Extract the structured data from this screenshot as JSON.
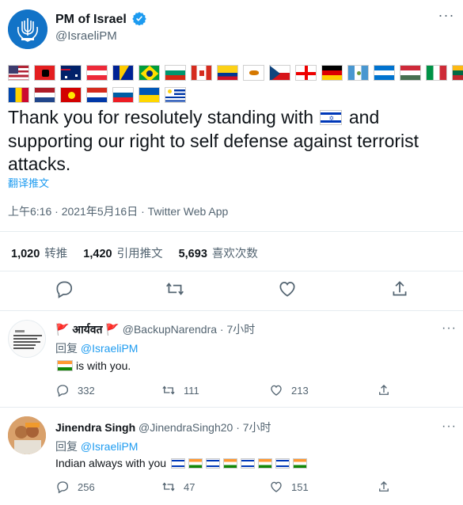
{
  "tweet": {
    "display_name": "PM of Israel",
    "handle": "@IsraeliPM",
    "text_before_flag": "Thank you for resolutely standing with",
    "text_after_flag": "and supporting our right to self defense against terrorist attacks.",
    "translate_label": "翻译推文",
    "timestamp": "上午6:16 · 2021年5月16日 · Twitter Web App",
    "stats": {
      "retweets_count": "1,020",
      "retweets_label": "转推",
      "quotes_count": "1,420",
      "quotes_label": "引用推文",
      "likes_count": "5,693",
      "likes_label": "喜欢次数"
    },
    "flags_row1": [
      "us-flag",
      "albania-flag",
      "australia-flag",
      "austria-flag",
      "bosnia-flag",
      "brazil-flag",
      "bulgaria-flag",
      "canada-flag",
      "colombia-flag",
      "cyprus-flag",
      "czech-flag",
      "georgia-flag",
      "germany-flag",
      "guatemala-flag",
      "honduras-flag",
      "hungary-flag",
      "italy-flag",
      "lithuania-flag"
    ],
    "flags_row2": [
      "moldova-flag",
      "netherlands-flag",
      "north-macedonia-flag",
      "paraguay-flag",
      "slovenia-flag",
      "ukraine-flag",
      "uruguay-flag"
    ]
  },
  "replies": [
    {
      "name": "आर्यवत",
      "handle": "@BackupNarendra",
      "time": "· 7小时",
      "reply_prefix": "回复",
      "reply_to": "@IsraeliPM",
      "text": "is with you.",
      "avatar_text": "We thank our friends in #India for supporting and standing with #Israel in its war against terror",
      "counts": {
        "reply": "332",
        "retweet": "111",
        "like": "213"
      }
    },
    {
      "name": "Jinendra Singh",
      "handle": "@JinendraSingh20",
      "time": "· 7小时",
      "reply_prefix": "回复",
      "reply_to": "@IsraeliPM",
      "text": "Indian always with you",
      "counts": {
        "reply": "256",
        "retweet": "47",
        "like": "151"
      }
    }
  ],
  "colors": {
    "accent": "#1d9bf0",
    "text": "#0f1419",
    "muted": "#536471",
    "divider": "#e6ecf0"
  }
}
